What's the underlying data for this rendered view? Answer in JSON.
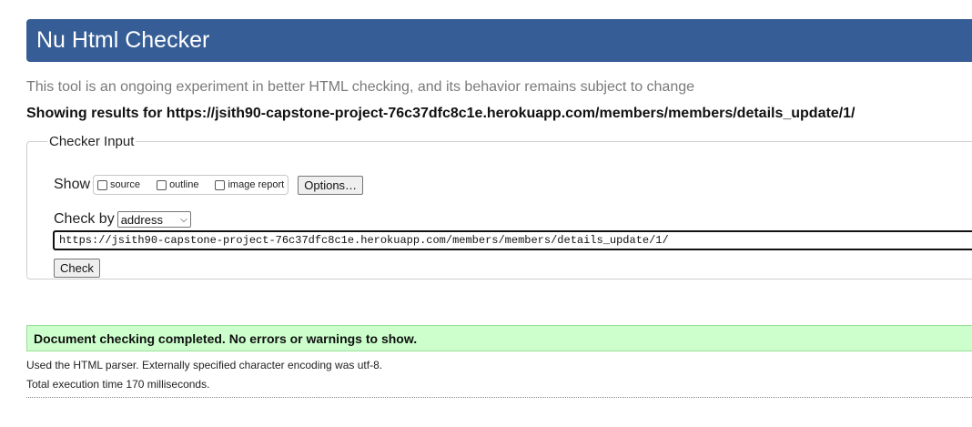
{
  "header": {
    "title": "Nu Html Checker"
  },
  "tagline": "This tool is an ongoing experiment in better HTML checking, and its behavior remains subject to change",
  "results_for": "Showing results for https://jsith90-capstone-project-76c37dfc8c1e.herokuapp.com/members/members/details_update/1/",
  "checker_input": {
    "legend": "Checker Input",
    "show_label": "Show",
    "show_options": [
      {
        "label": "source",
        "checked": false
      },
      {
        "label": "outline",
        "checked": false
      },
      {
        "label": "image report",
        "checked": false
      }
    ],
    "options_button": "Options…",
    "check_by_label": "Check by",
    "check_by_selected": "address",
    "url_value": "https://jsith90-capstone-project-76c37dfc8c1e.herokuapp.com/members/members/details_update/1/",
    "check_button": "Check"
  },
  "result": {
    "status": "Document checking completed. No errors or warnings to show.",
    "status_color": "#ccffcc",
    "parser_info": "Used the HTML parser. Externally specified character encoding was utf-8.",
    "execution_time": "Total execution time 170 milliseconds."
  },
  "colors": {
    "header_bg": "#365d95",
    "tagline": "#7a7a7a"
  },
  "icons": {
    "select_arrow": "chevron-down-icon"
  }
}
